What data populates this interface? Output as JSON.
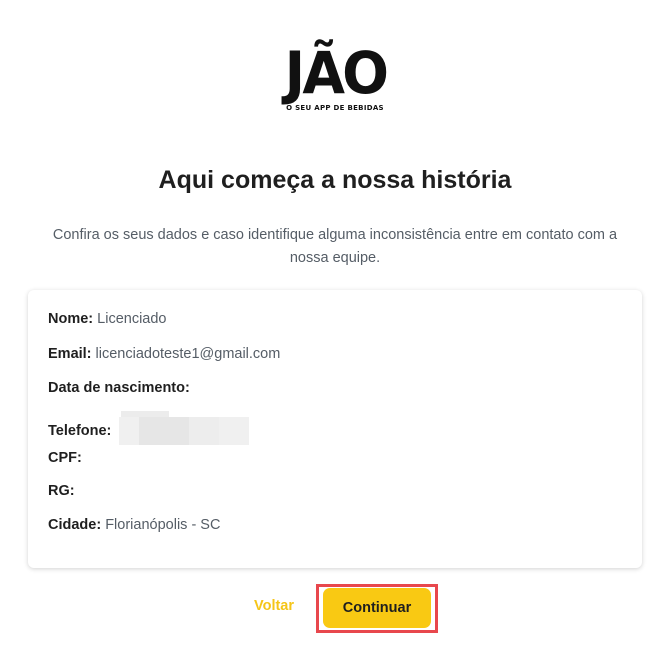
{
  "logo": {
    "wordmark": "JÃO",
    "tagline": "O SEU APP DE BEBIDAS"
  },
  "title": "Aqui começa a nossa história",
  "subtitle": "Confira os seus dados e caso identifique alguma inconsistência entre em contato com a nossa equipe.",
  "fields": [
    {
      "label": "Nome:",
      "value": "Licenciado"
    },
    {
      "label": "Email:",
      "value": "licenciadoteste1@gmail.com"
    },
    {
      "label": "Data de nascimento:",
      "value": ""
    },
    {
      "label": "Telefone:",
      "value": ""
    },
    {
      "label": "CPF:",
      "value": ""
    },
    {
      "label": "RG:",
      "value": ""
    },
    {
      "label": "Cidade:",
      "value": "Florianópolis - SC"
    }
  ],
  "actions": {
    "back_label": "Voltar",
    "continue_label": "Continuar"
  },
  "colors": {
    "accent": "#f9c913",
    "highlight": "#e8474d",
    "text": "#1f1f1f",
    "muted": "#555d66"
  }
}
